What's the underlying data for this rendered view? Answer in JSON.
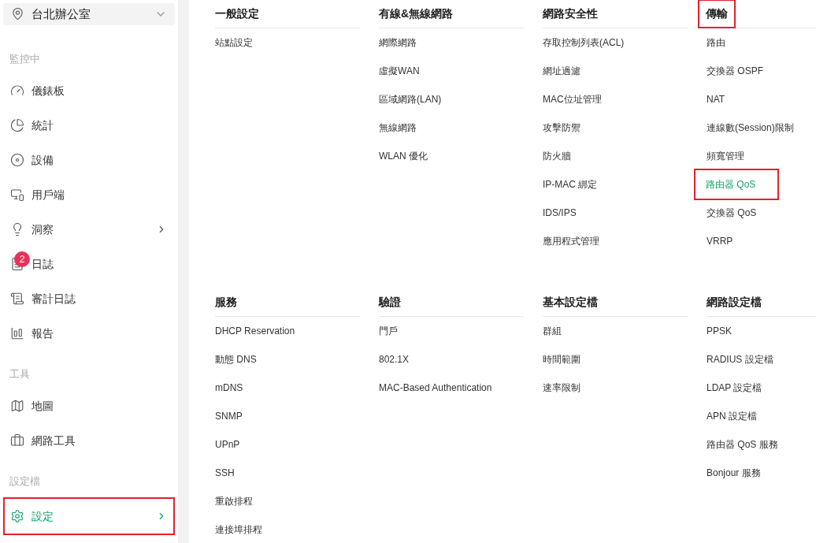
{
  "location_selector": {
    "label": "台北辦公室"
  },
  "sidebar": {
    "sections": [
      {
        "title": "監控中",
        "items": [
          {
            "label": "儀錶板",
            "kind": "gauge",
            "selected": false,
            "highlighted": false,
            "has_submenu": false
          },
          {
            "label": "統計",
            "kind": "pie",
            "selected": false,
            "highlighted": false,
            "has_submenu": false
          },
          {
            "label": "設備",
            "kind": "device",
            "selected": false,
            "highlighted": false,
            "has_submenu": false
          },
          {
            "label": "用戶端",
            "kind": "client",
            "selected": false,
            "highlighted": false,
            "has_submenu": false
          },
          {
            "label": "洞察",
            "kind": "bulb",
            "selected": false,
            "highlighted": false,
            "has_submenu": true
          },
          {
            "label": "日誌",
            "kind": "log",
            "badge": "2",
            "selected": false,
            "highlighted": false,
            "has_submenu": false
          },
          {
            "label": "審計日誌",
            "kind": "list",
            "selected": false,
            "highlighted": false,
            "has_submenu": false
          },
          {
            "label": "報告",
            "kind": "report",
            "selected": false,
            "highlighted": false,
            "has_submenu": false
          }
        ]
      },
      {
        "title": "工具",
        "items": [
          {
            "label": "地圖",
            "kind": "map",
            "selected": false,
            "highlighted": false,
            "has_submenu": false
          },
          {
            "label": "網路工具",
            "kind": "toolbox",
            "selected": false,
            "highlighted": false,
            "has_submenu": false
          }
        ]
      },
      {
        "title": "設定檔",
        "items": [
          {
            "label": "設定",
            "kind": "settings",
            "selected": true,
            "highlighted": true,
            "has_submenu": true
          }
        ]
      }
    ]
  },
  "menu_groups": [
    {
      "title": "一般設定",
      "highlighted": false,
      "items": [
        {
          "label": "站點設定",
          "selected": false,
          "highlighted": false
        }
      ]
    },
    {
      "title": "有線&無線網路",
      "highlighted": false,
      "items": [
        {
          "label": "網際網路",
          "selected": false,
          "highlighted": false
        },
        {
          "label": "虛擬WAN",
          "selected": false,
          "highlighted": false
        },
        {
          "label": "區域網路(LAN)",
          "selected": false,
          "highlighted": false
        },
        {
          "label": "無線網路",
          "selected": false,
          "highlighted": false
        },
        {
          "label": "WLAN 優化",
          "selected": false,
          "highlighted": false
        }
      ]
    },
    {
      "title": "網路安全性",
      "highlighted": false,
      "items": [
        {
          "label": "存取控制列表(ACL)",
          "selected": false,
          "highlighted": false
        },
        {
          "label": "網址過濾",
          "selected": false,
          "highlighted": false
        },
        {
          "label": "MAC位址管理",
          "selected": false,
          "highlighted": false
        },
        {
          "label": "攻擊防禦",
          "selected": false,
          "highlighted": false
        },
        {
          "label": "防火牆",
          "selected": false,
          "highlighted": false
        },
        {
          "label": "IP-MAC 綁定",
          "selected": false,
          "highlighted": false
        },
        {
          "label": "IDS/IPS",
          "selected": false,
          "highlighted": false
        },
        {
          "label": "應用程式管理",
          "selected": false,
          "highlighted": false
        }
      ]
    },
    {
      "title": "傳輸",
      "highlighted": true,
      "items": [
        {
          "label": "路由",
          "selected": false,
          "highlighted": false
        },
        {
          "label": "交換器 OSPF",
          "selected": false,
          "highlighted": false
        },
        {
          "label": "NAT",
          "selected": false,
          "highlighted": false
        },
        {
          "label": "連線數(Session)限制",
          "selected": false,
          "highlighted": false
        },
        {
          "label": "頻寬管理",
          "selected": false,
          "highlighted": false
        },
        {
          "label": "路由器 QoS",
          "selected": true,
          "highlighted": true
        },
        {
          "label": "交換器 QoS",
          "selected": false,
          "highlighted": false
        },
        {
          "label": "VRRP",
          "selected": false,
          "highlighted": false
        }
      ]
    },
    {
      "title": "服務",
      "highlighted": false,
      "items": [
        {
          "label": "DHCP Reservation",
          "selected": false,
          "highlighted": false
        },
        {
          "label": "動態 DNS",
          "selected": false,
          "highlighted": false
        },
        {
          "label": "mDNS",
          "selected": false,
          "highlighted": false
        },
        {
          "label": "SNMP",
          "selected": false,
          "highlighted": false
        },
        {
          "label": "UPnP",
          "selected": false,
          "highlighted": false
        },
        {
          "label": "SSH",
          "selected": false,
          "highlighted": false
        },
        {
          "label": "重啟排程",
          "selected": false,
          "highlighted": false
        },
        {
          "label": "連接埠排程",
          "selected": false,
          "highlighted": false
        }
      ]
    },
    {
      "title": "驗證",
      "highlighted": false,
      "items": [
        {
          "label": "門戶",
          "selected": false,
          "highlighted": false
        },
        {
          "label": "802.1X",
          "selected": false,
          "highlighted": false
        },
        {
          "label": "MAC-Based Authentication",
          "selected": false,
          "highlighted": false
        }
      ]
    },
    {
      "title": "基本設定檔",
      "highlighted": false,
      "items": [
        {
          "label": "群組",
          "selected": false,
          "highlighted": false
        },
        {
          "label": "時間範圍",
          "selected": false,
          "highlighted": false
        },
        {
          "label": "速率限制",
          "selected": false,
          "highlighted": false
        }
      ]
    },
    {
      "title": "網路設定檔",
      "highlighted": false,
      "items": [
        {
          "label": "PPSK",
          "selected": false,
          "highlighted": false
        },
        {
          "label": "RADIUS 設定檔",
          "selected": false,
          "highlighted": false
        },
        {
          "label": "LDAP 設定檔",
          "selected": false,
          "highlighted": false
        },
        {
          "label": "APN 設定檔",
          "selected": false,
          "highlighted": false
        },
        {
          "label": "路由器 QoS 服務",
          "selected": false,
          "highlighted": false
        },
        {
          "label": "Bonjour 服務",
          "selected": false,
          "highlighted": false
        }
      ]
    }
  ]
}
